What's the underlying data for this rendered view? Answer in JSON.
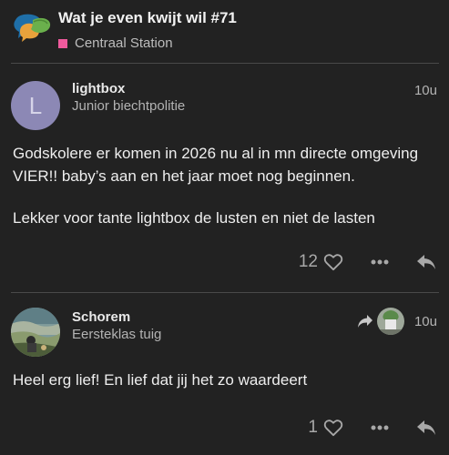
{
  "topic": {
    "title": "Wat je even kwijt wil #71",
    "category": "Centraal Station",
    "category_color": "#f05a9d",
    "logo_icon": "speech-bubbles-logo-icon"
  },
  "posts": [
    {
      "username": "lightbox",
      "user_title": "Junior biechtpolitie",
      "avatar_letter": "L",
      "avatar_color": "#8c88b5",
      "age": "10u",
      "paragraphs": [
        "Godskolere er komen in 2026 nu al in mn directe omgeving VIER!! baby’s aan en het jaar moet nog beginnen.",
        "Lekker voor tante lightbox de lusten en niet de lasten"
      ],
      "like_count": "12"
    },
    {
      "username": "Schorem",
      "user_title": "Eersteklas tuig",
      "age": "10u",
      "paragraphs": [
        "Heel erg lief! En lief dat jij het zo waardeert"
      ],
      "like_count": "1",
      "reply_to_icon": "reply-arrow-icon"
    }
  ],
  "icons": {
    "like": "heart-icon",
    "more": "more-dots-icon",
    "reply": "reply-icon"
  }
}
